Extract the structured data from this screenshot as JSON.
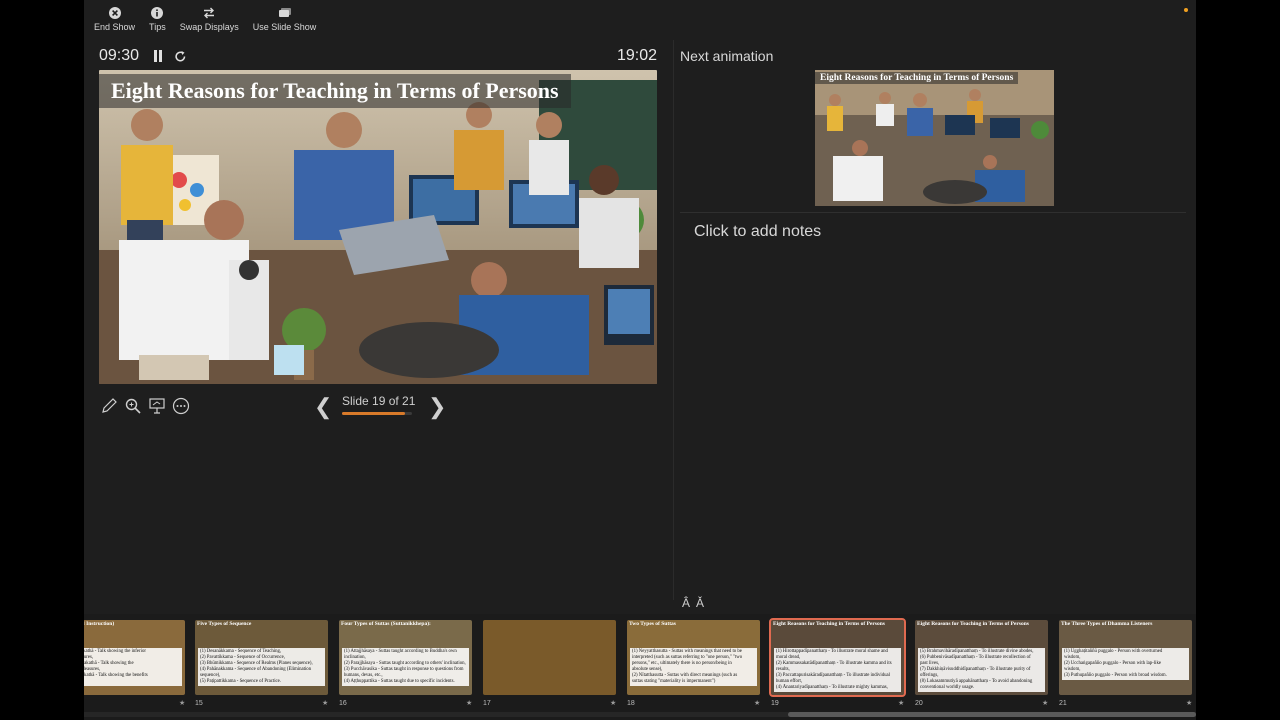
{
  "toolbar": {
    "end_show": "End Show",
    "tips": "Tips",
    "swap_displays": "Swap Displays",
    "use_slide_show": "Use Slide Show"
  },
  "timer": {
    "elapsed": "09:30",
    "clock": "19:02"
  },
  "slide": {
    "title": "Eight Reasons for Teaching in Terms of Persons"
  },
  "nav": {
    "slide_counter": "Slide 19 of 21",
    "progress_fraction": 0.905
  },
  "next": {
    "label": "Next animation",
    "title": "Eight Reasons for Teaching in Terms of Persons"
  },
  "notes": {
    "placeholder": "Click to add notes"
  },
  "font_controls": {
    "increase": "Â",
    "decrease": "Ǎ"
  },
  "thumbnails": [
    {
      "num": "",
      "title": "thā (Gradual Instruction)",
      "lines": [
        "...anu odārikakathā - Talk showing the inferior",
        "...ensual pleasures,",
        "...anu ānisaṃsakathā - Talk showing the",
        "...of sensual pleasures,",
        "...nekkhammakathā - Talk showing the benefits",
        "...ation."
      ]
    },
    {
      "num": "15",
      "title": "Five Types of Sequence",
      "lines": [
        "(1) Desanākkama - Sequence of Teaching,",
        "(2) Pavattikkama - Sequence of Occurrence,",
        "(3) Bhūmikkama - Sequence of Realms (Planes sequence),",
        "(4) Pahānakkama - Sequence of Abandoning (Elimination",
        "sequence),",
        "(5) Paṭipattikkama - Sequence of Practice."
      ]
    },
    {
      "num": "16",
      "title": "Four Types of Suttas (Suttanikkhepa):",
      "lines": [
        "(1) Attajjhāsaya - Suttas taught according to Buddha's own",
        "inclination,",
        "(2) Parajjhāsaya - Suttas taught according to others' inclination,",
        "(3) Pucchāvasika - Suttas taught in response to questions from",
        "humans, devas, etc.,",
        "(4) Aṭṭhuppattika - Suttas taught due to specific incidents."
      ]
    },
    {
      "num": "17",
      "title": "",
      "lines": []
    },
    {
      "num": "18",
      "title": "Two Types of Suttas",
      "lines": [
        "(1) Neyyatthasutta - Suttas with meanings that need to be",
        "interpreted (such as suttas referring to \"one person,\" \"two",
        "persons,\" etc., ultimately there is no person/being in",
        "absolute sense),",
        "(2) Nītatthasutta - Suttas with direct meanings (such as",
        "suttas stating \"materiality is impermanent\")"
      ]
    },
    {
      "num": "19",
      "title": "Eight Reasons for Teaching in Terms of Persons",
      "lines": [
        "(1) Hirottappadīpanatthaṃ - To illustrate moral shame and",
        "moral dread,",
        "(2) Kammassakatādīpanatthaṃ - To illustrate kamma and its",
        "results,",
        "(3) Paccattapurisakāradīpanatthaṃ - To illustrate individual",
        "human effort,",
        "(4) Ānantariyadīpanatthaṃ - To illustrate mighty kammas,"
      ]
    },
    {
      "num": "20",
      "title": "Eight Reasons for Teaching in Terms of Persons",
      "lines": [
        "(5) Brahmavihāradīpanatthaṃ - To illustrate divine abodes,",
        "(6) Pubbenivāsadīpanatthaṃ - To illustrate recollection of",
        "past lives,",
        "(7) Dakkhiṇāvisuddhidīpanatthaṃ - To illustrate purity of",
        "offerings,",
        "(8) Lokasammutiyā appahānatthaṃ - To avoid abandoning",
        "conventional worldly usage."
      ]
    },
    {
      "num": "21",
      "title": "The Three Types of Dhamma Listeners",
      "lines": [
        "(1) Ugghaṭitaññū puggalo - Person with overturned",
        "wisdom,",
        "(2) Ucchaṅgapañño puggalo - Person with lap-like",
        "wisdom,",
        "(3) Puthupañño puggalo - Person with broad wisdom."
      ]
    }
  ],
  "colors": {
    "accent": "#d87a2a",
    "selected_outline": "#e06a50",
    "background": "#1e1e1e"
  }
}
